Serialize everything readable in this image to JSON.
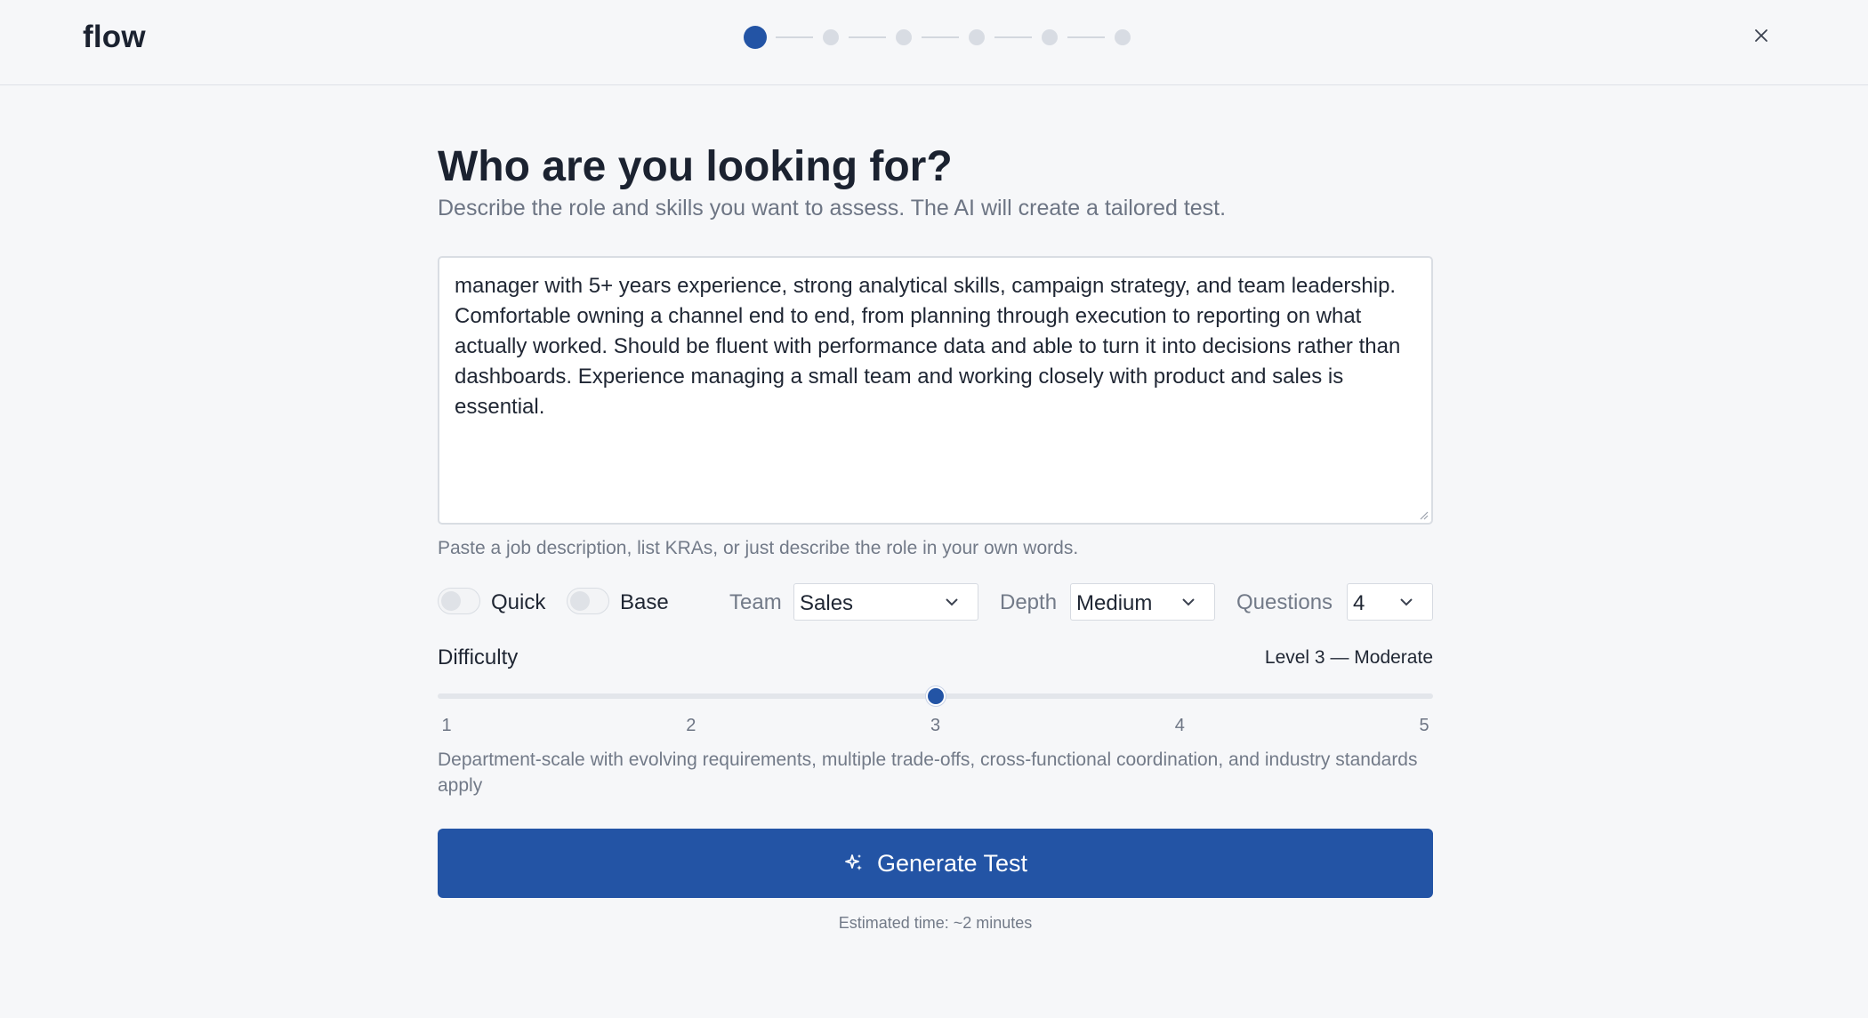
{
  "header": {
    "logo": "flow",
    "steps": {
      "total": 6,
      "current": 1
    },
    "close_icon": "close-icon"
  },
  "main": {
    "title": "Who are you looking for?",
    "subtitle": "Describe the role and skills you want to assess. The AI will create a tailored test.",
    "role_description": "manager with 5+ years experience, strong analytical skills, campaign strategy, and team leadership. Comfortable owning a channel end to end, from planning through execution to reporting on what actually worked. Should be fluent with performance data and able to turn it into decisions rather than dashboards. Experience managing a small team and working closely with product and sales is essential.",
    "hint": "Paste a job description, list KRAs, or just describe the role in your own words."
  },
  "controls": {
    "quick": {
      "label": "Quick",
      "on": false
    },
    "base": {
      "label": "Base",
      "on": false
    },
    "team": {
      "label": "Team",
      "value": "Sales"
    },
    "depth": {
      "label": "Depth",
      "value": "Medium"
    },
    "questions": {
      "label": "Questions",
      "value": "4"
    }
  },
  "difficulty": {
    "label": "Difficulty",
    "level_text": "Level 3 — Moderate",
    "value": 3,
    "min": 1,
    "max": 5,
    "ticks": [
      "1",
      "2",
      "3",
      "4",
      "5"
    ],
    "description": "Department-scale with evolving requirements, multiple trade-offs, cross-functional coordination, and industry standards apply"
  },
  "actions": {
    "generate_label": "Generate Test",
    "generate_icon": "sparkle-icon",
    "estimate": "Estimated time: ~2 minutes"
  },
  "colors": {
    "accent": "#2354a5",
    "background": "#f6f7f9"
  }
}
